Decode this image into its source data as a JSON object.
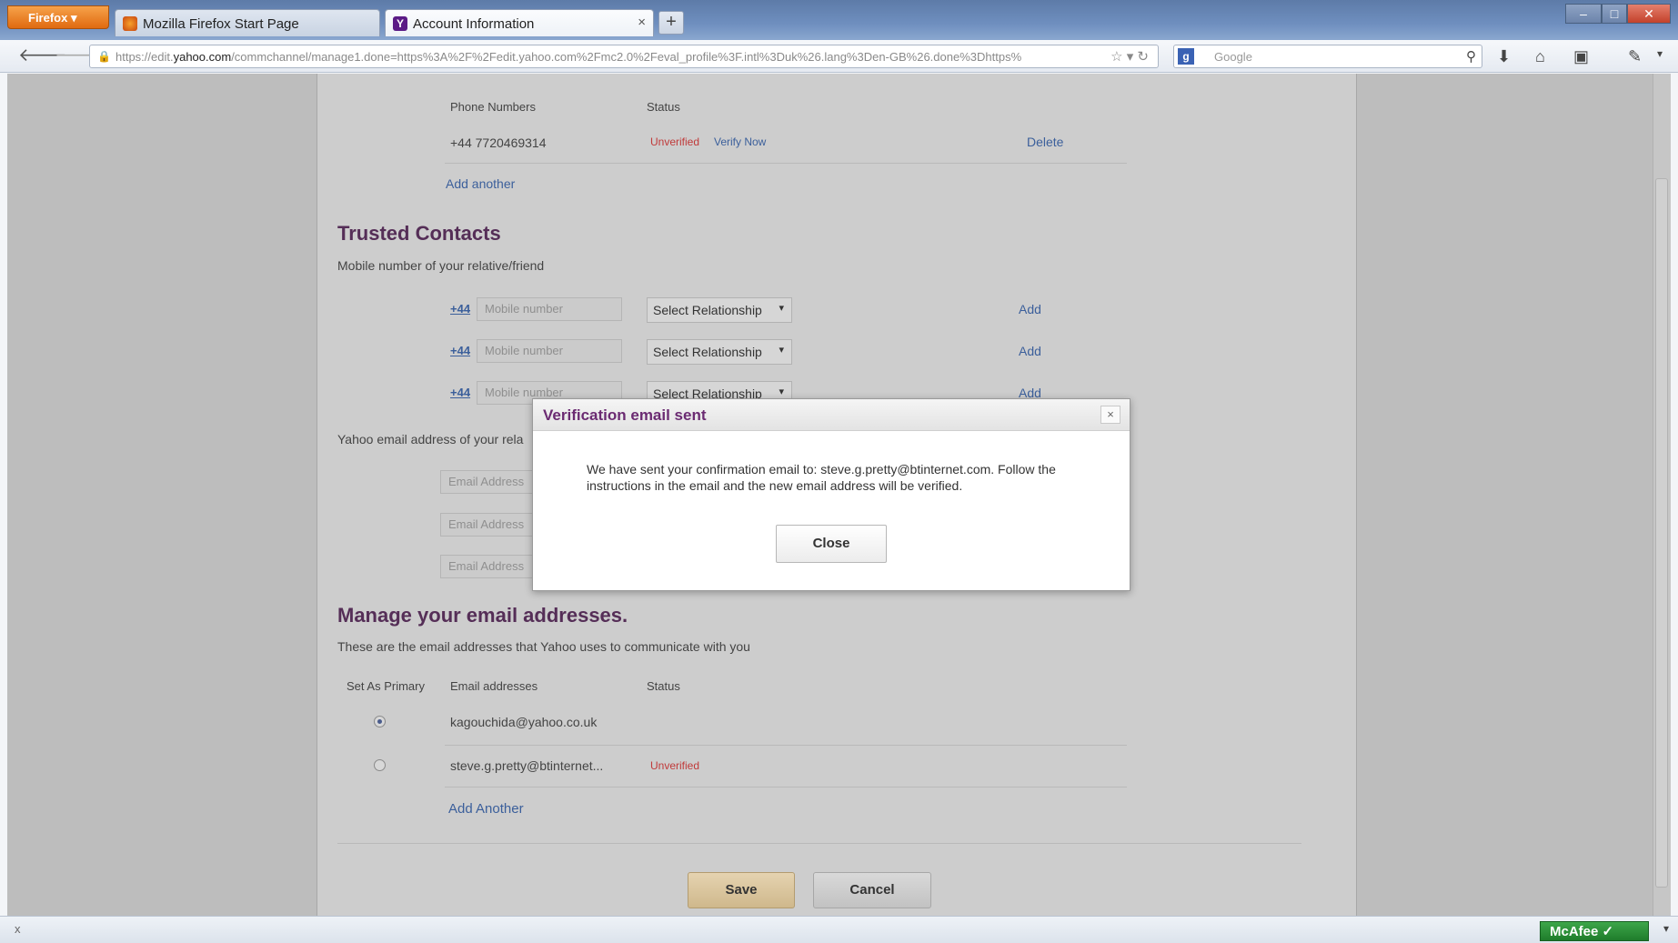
{
  "browser": {
    "menu_label": "Firefox",
    "tabs": [
      {
        "title": "Mozilla Firefox Start Page",
        "icon": "firefox-icon"
      },
      {
        "title": "Account Information",
        "icon": "yahoo-icon"
      }
    ],
    "url_prefix": "https://edit.",
    "url_domain": "yahoo.com",
    "url_rest": "/commchannel/manage1.done=https%3A%2F%2Fedit.yahoo.com%2Fmc2.0%2Feval_profile%3F.intl%3Duk%26.lang%3Den-GB%26.done%3Dhttps%",
    "search_placeholder": "Google",
    "status_left": "x",
    "mcafee_label": "McAfee"
  },
  "phones": {
    "col_number": "Phone Numbers",
    "col_status": "Status",
    "rows": [
      {
        "number": "+44 7720469314",
        "status": "Unverified",
        "verify": "Verify Now",
        "delete": "Delete"
      }
    ],
    "add_another": "Add another"
  },
  "trusted": {
    "title": "Trusted Contacts",
    "subtitle": "Mobile number of your relative/friend",
    "rows": [
      {
        "cc": "+44",
        "placeholder": "Mobile number",
        "relationship": "Select Relationship",
        "add": "Add"
      },
      {
        "cc": "+44",
        "placeholder": "Mobile number",
        "relationship": "Select Relationship",
        "add": "Add"
      },
      {
        "cc": "+44",
        "placeholder": "Mobile number",
        "relationship": "Select Relationship",
        "add": "Add"
      }
    ],
    "email_label": "Yahoo email address of your rela",
    "email_placeholders": [
      "Email Address",
      "Email Address",
      "Email Address"
    ]
  },
  "manage": {
    "title": "Manage your email addresses.",
    "subtitle": "These are the email addresses that Yahoo uses to communicate with you",
    "col_primary": "Set As Primary",
    "col_email": "Email addresses",
    "col_status": "Status",
    "rows": [
      {
        "email": "kagouchida@yahoo.co.uk",
        "status": "",
        "primary": true
      },
      {
        "email": "steve.g.pretty@btinternet...",
        "status": "Unverified",
        "primary": false
      }
    ],
    "add_another": "Add Another"
  },
  "actions": {
    "save": "Save",
    "cancel": "Cancel"
  },
  "dialog": {
    "title": "Verification email sent",
    "close_x": "×",
    "message": "We have sent your confirmation email to: steve.g.pretty@btinternet.com. Follow the instructions in the email and the new email address will be verified.",
    "close_button": "Close"
  }
}
